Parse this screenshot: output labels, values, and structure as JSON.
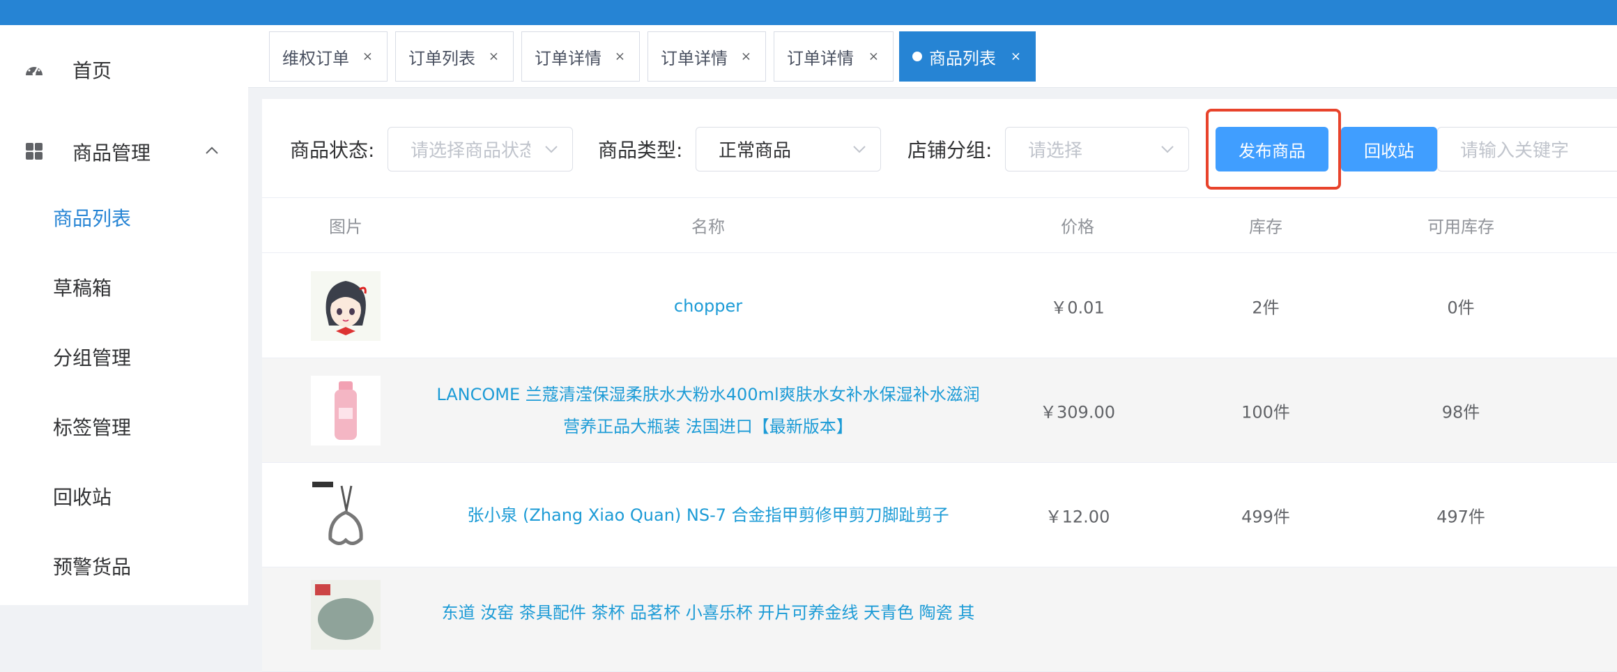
{
  "sidebar": {
    "home_label": "首页",
    "goods_mgmt_label": "商品管理",
    "sub_items": [
      {
        "label": "商品列表"
      },
      {
        "label": "草稿箱"
      },
      {
        "label": "分组管理"
      },
      {
        "label": "标签管理"
      },
      {
        "label": "回收站"
      },
      {
        "label": "预警货品"
      }
    ]
  },
  "tabs": [
    {
      "label": "维权订单"
    },
    {
      "label": "订单列表"
    },
    {
      "label": "订单详情"
    },
    {
      "label": "订单详情"
    },
    {
      "label": "订单详情"
    },
    {
      "label": "商品列表"
    }
  ],
  "tab_close": "×",
  "filters": {
    "status_label": "商品状态:",
    "status_placeholder": "请选择商品状态",
    "type_label": "商品类型:",
    "type_value": "正常商品",
    "group_label": "店铺分组:",
    "group_placeholder": "请选择",
    "publish_button": "发布商品",
    "recycle_button": "回收站",
    "keyword_placeholder": "请输入关键字"
  },
  "table": {
    "headers": {
      "image": "图片",
      "name": "名称",
      "price": "价格",
      "stock": "库存",
      "available": "可用库存"
    },
    "rows": [
      {
        "name": "chopper",
        "price": "￥0.01",
        "stock": "2件",
        "available": "0件"
      },
      {
        "name": "LANCOME 兰蔻清滢保湿柔肤水大粉水400ml爽肤水女补水保湿补水滋润营养正品大瓶装 法国进口【最新版本】",
        "price": "￥309.00",
        "stock": "100件",
        "available": "98件"
      },
      {
        "name": "张小泉 (Zhang Xiao Quan) NS-7 合金指甲剪修甲剪刀脚趾剪子",
        "price": "￥12.00",
        "stock": "499件",
        "available": "497件"
      },
      {
        "name": "东道 汝窑 茶具配件 茶杯 品茗杯 小喜乐杯 开片可养金线 天青色 陶瓷 其",
        "price": "",
        "stock": "",
        "available": ""
      }
    ]
  },
  "colors": {
    "topbar": "#2684d4",
    "active_tab": "#2684d4",
    "primary_button": "#409eff",
    "highlight_border": "#e8432b",
    "link_text": "#1c9bd6"
  },
  "icons": [
    "dashboard-icon",
    "grid-icon",
    "chevron-up-icon",
    "close-icon",
    "chevron-down-icon"
  ]
}
